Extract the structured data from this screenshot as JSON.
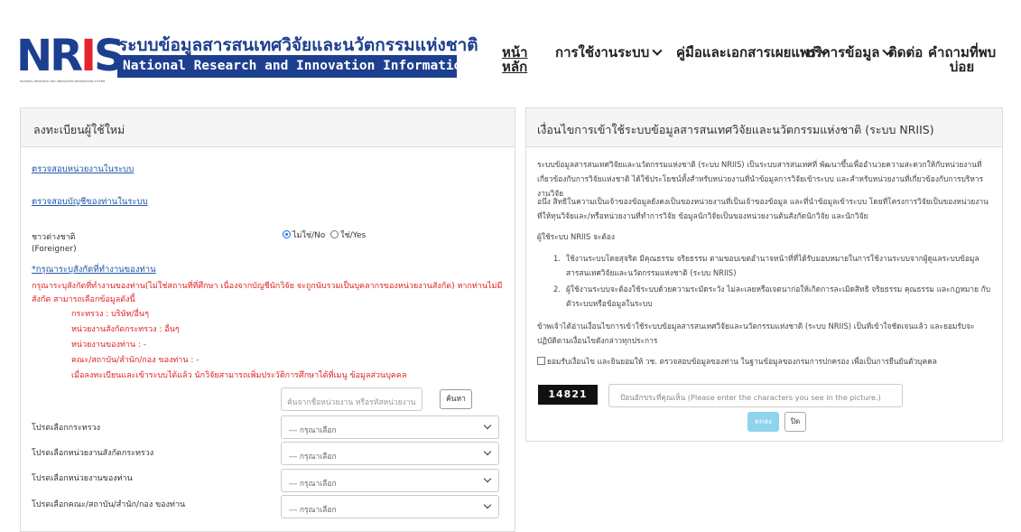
{
  "brand": {
    "logo_left": "NR",
    "logo_r": "I",
    "logo_right": "S",
    "logo_sub": "NATIONAL RESEARCH AND INNOVATION INFORMATION SYSTEM",
    "title_th": "ระบบข้อมูลสารสนเทศวิจัยและนวัตกรรมแห่งชาติ",
    "title_en": "National Research and Innovation Information System",
    "colors": {
      "primary": "#1d3f8f",
      "accent": "#e3262d"
    }
  },
  "nav": {
    "home_line1": "หน้า",
    "home_line2": "หลัก",
    "usage": "การใช้งานระบบ",
    "manuals": "คู่มือและเอกสารเผยแพร่",
    "services": "บริการข้อมูล",
    "contact": "ติดต่อ",
    "faq_line1": "คำถามที่พบ",
    "faq_line2": "บ่อย"
  },
  "register": {
    "title": "ลงทะเบียนผู้ใช้ใหม่",
    "link_check_agency": "ตรวจสอบหน่วยงานในระบบ",
    "link_check_account": "ตรวจสอบบัญชีของท่านในระบบ",
    "foreigner_label": "ชาวต่างชาติ",
    "foreigner_sub": "(Foreigner)",
    "radio_no": "ไม่ใช่/No",
    "radio_yes": "ใช่/Yes",
    "link_specify_agency": "*กรุณาระบุสังกัดที่ทำงานของท่าน",
    "note": "กรุณาระบุสังกัดที่ทำงานของท่าน(ไม่ใช่สถานที่ที่ศึกษา เนื่องจากบัญชีนักวิจัย จะถูกนับรวมเป็นบุคลากรของหน่วยงานสังกัด) หากท่านไม่มีสังกัด สามารถเลือกข้อมูลดังนี้",
    "list": [
      "กระทรวง : บริษัท/อื่นๆ",
      "หน่วยงานสังกัดกระทรวง : อื่นๆ",
      "หน่วยงานของท่าน : -",
      "คณะ/สถาบัน/สำนัก/กอง ของท่าน : -",
      "เมื่อลงทะเบียนและเข้าระบบได้แล้ว นักวิจัยสามารถเพิ่มประวัติการศึกษาได้ที่เมนู ข้อมูลส่วนบุคคล"
    ],
    "search_placeholder": "ค้นจากชื่อหน่วยงาน หรือรหัสหน่วยงาน",
    "search_button": "ค้นหา",
    "selects": [
      {
        "label": "โปรดเลือกกระทรวง",
        "value": "--- กรุณาเลือก"
      },
      {
        "label": "โปรดเลือกหน่วยงานสังกัดกระทรวง",
        "value": "--- กรุณาเลือก"
      },
      {
        "label": "โปรดเลือกหน่วยงานของท่าน",
        "value": "--- กรุณาเลือก"
      },
      {
        "label": "โปรดเลือกคณะ/สถาบัน/สำนัก/กอง ของท่าน",
        "value": "--- กรุณาเลือก"
      }
    ]
  },
  "terms": {
    "title": "เงื่อนไขการเข้าใช้ระบบข้อมูลสารสนเทศวิจัยและนวัตกรรมแห่งชาติ (ระบบ NRIIS)",
    "para1": "ระบบข้อมูลสารสนเทศวิจัยและนวัตกรรมแห่งชาติ (ระบบ NRIIS) เป็นระบบสารสนเทศที่ พัฒนาขึ้นเพื่ออำนวยความสะดวกให้กับหน่วยงานที่เกี่ยวข้องกับการวิจัยแห่งชาติ ได้ใช้ประโยชน์ทั้งสำหรับหน่วยงานที่นำข้อมูลการวิจัยเข้าระบบ และสำหรับหน่วยงานที่เกี่ยวข้องกับการบริหารงานวิจัย",
    "para2": "อนึ่ง สิทธิในความเป็นเจ้าของข้อมูลยังคงเป็นของหน่วยงานที่เป็นเจ้าของข้อมูล และที่นำข้อมูลเข้าระบบ โดยที่โครงการวิจัยเป็นของหน่วยงานที่ให้ทุนวิจัยและ/หรือหน่วยงานที่ทำการวิจัย ข้อมูลนักวิจัยเป็นของหน่วยงานต้นสังกัดนักวิจัย และนักวิจัย",
    "para3": "ผู้ใช้ระบบ NRIIS จะต้อง",
    "items": [
      "ใช้งานระบบโดยสุจริต มีคุณธรรม จริยธรรม ตามขอบเขตอำนาจหน้าที่ที่ได้รับมอบหมายในการใช้งานระบบจากผู้ดูแลระบบข้อมูลสารสนเทศวิจัยและนวัตกรรมแห่งชาติ (ระบบ NRIIS)",
      "ผู้ใช้งานระบบจะต้องใช้ระบบด้วยความระมัดระวัง ไม่ละเลยหรือเจตนาก่อให้เกิดการละเมิดสิทธิ จริยธรรม คุณธรรม และกฎหมาย กับตัวระบบหรือข้อมูลในระบบ"
    ],
    "para4": "ข้าพเจ้าได้อ่านเงื่อนไขการเข้าใช้ระบบข้อมูลสารสนเทศวิจัยและนวัตกรรมแห่งชาติ (ระบบ NRIIS) เป็นที่เข้าใจชัดเจนแล้ว และยอมรับจะปฏิบัติตามเงื่อนไขดังกล่าวทุกประการ",
    "consent": "ยอมรับเงื่อนไข และยินยอมให้ วช. ตรวจสอบข้อมูลของท่าน ในฐานข้อมูลของกรมการปกครอง เพื่อเป็นการยืนยันตัวบุคคล",
    "captcha_code": "14821",
    "captcha_placeholder": "ป้อนอักขระที่คุณเห็น (Please enter the characters you see in the picture.)",
    "ok_button": "ตกลง",
    "close_button": "ปิด"
  }
}
